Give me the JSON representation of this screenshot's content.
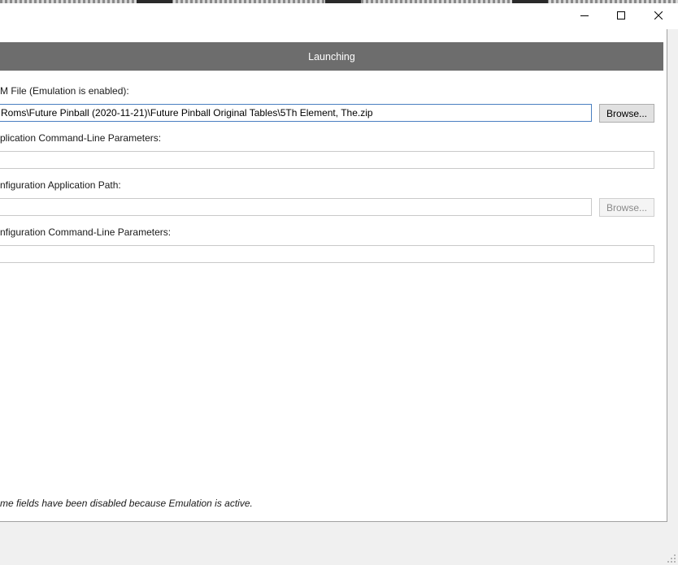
{
  "window": {
    "minimize_icon": "minimize-icon",
    "maximize_icon": "maximize-icon",
    "close_icon": "close-icon"
  },
  "section": {
    "title": "Launching"
  },
  "rom_file": {
    "label": "M File (Emulation is enabled):",
    "value": "Roms\\Future Pinball (2020-11-21)\\Future Pinball Original Tables\\5Th Element, The.zip",
    "browse_label": "Browse..."
  },
  "app_params": {
    "label": "plication Command-Line Parameters:",
    "value": ""
  },
  "config_path": {
    "label": "nfiguration Application Path:",
    "value": "",
    "browse_label": "Browse..."
  },
  "config_params": {
    "label": "nfiguration Command-Line Parameters:",
    "value": ""
  },
  "footer": {
    "note": "me fields have been disabled because Emulation is active."
  },
  "colors": {
    "header_bg": "#6d6d6d",
    "focus_border": "#4a7fc1",
    "window_bg": "#f0f0f0"
  }
}
